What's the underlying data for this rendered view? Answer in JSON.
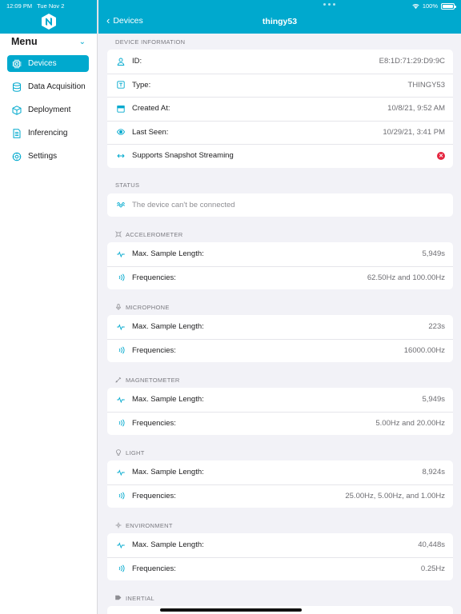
{
  "statusbar": {
    "time": "12:09 PM",
    "date": "Tue Nov 2",
    "battery": "100%"
  },
  "sidebar": {
    "menu_title": "Menu",
    "items": [
      {
        "label": "Devices",
        "icon": "chip-icon",
        "active": true
      },
      {
        "label": "Data Acquisition",
        "icon": "database-icon",
        "active": false
      },
      {
        "label": "Deployment",
        "icon": "cube-icon",
        "active": false
      },
      {
        "label": "Inferencing",
        "icon": "document-icon",
        "active": false
      },
      {
        "label": "Settings",
        "icon": "gear-icon",
        "active": false
      }
    ]
  },
  "navbar": {
    "back_label": "Devices",
    "title": "thingy53"
  },
  "device_info": {
    "header": "DEVICE INFORMATION",
    "id_label": "ID:",
    "id_value": "E8:1D:71:29:D9:9C",
    "type_label": "Type:",
    "type_value": "THINGY53",
    "created_label": "Created At:",
    "created_value": "10/8/21, 9:52 AM",
    "seen_label": "Last Seen:",
    "seen_value": "10/29/21, 3:41 PM",
    "snapshot_label": "Supports Snapshot Streaming",
    "snapshot_supported": false
  },
  "status": {
    "header": "STATUS",
    "text": "The device can't be connected"
  },
  "sensors": [
    {
      "name": "ACCELEROMETER",
      "icon": "accelerometer-icon",
      "sample_label": "Max. Sample Length:",
      "sample_value": "5,949s",
      "freq_label": "Frequencies:",
      "freq_value": "62.50Hz and 100.00Hz"
    },
    {
      "name": "MICROPHONE",
      "icon": "microphone-icon",
      "sample_label": "Max. Sample Length:",
      "sample_value": "223s",
      "freq_label": "Frequencies:",
      "freq_value": "16000.00Hz"
    },
    {
      "name": "MAGNETOMETER",
      "icon": "magnetometer-icon",
      "sample_label": "Max. Sample Length:",
      "sample_value": "5,949s",
      "freq_label": "Frequencies:",
      "freq_value": "5.00Hz and 20.00Hz"
    },
    {
      "name": "LIGHT",
      "icon": "lightbulb-icon",
      "sample_label": "Max. Sample Length:",
      "sample_value": "8,924s",
      "freq_label": "Frequencies:",
      "freq_value": "25.00Hz, 5.00Hz, and 1.00Hz"
    },
    {
      "name": "ENVIRONMENT",
      "icon": "environment-icon",
      "sample_label": "Max. Sample Length:",
      "sample_value": "40,448s",
      "freq_label": "Frequencies:",
      "freq_value": "0.25Hz"
    },
    {
      "name": "INERTIAL",
      "icon": "inertial-icon"
    }
  ],
  "colors": {
    "accent": "#00a9ce",
    "error": "#e5253f",
    "background": "#f2f2f7"
  }
}
